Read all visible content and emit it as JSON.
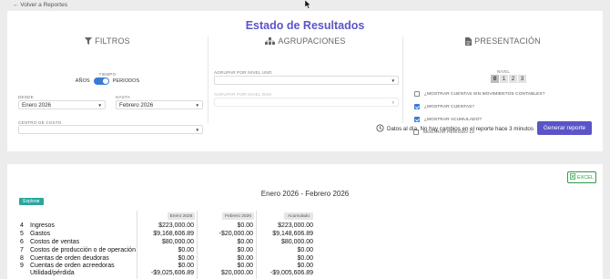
{
  "nav": {
    "back_label": "← Volver a Reportes"
  },
  "page": {
    "title": "Estado de Resultados"
  },
  "filters": {
    "heading": "FILTROS",
    "tiempo_label": "TIEMPO",
    "toggle_left": "AÑOS",
    "toggle_right": "PERIODOS",
    "toggle_state": "PERIODOS",
    "desde_label": "DESDE",
    "desde_value": "Enero 2026",
    "hasta_label": "HASTA",
    "hasta_value": "Febrero 2026",
    "centro_label": "CENTRO DE COSTO",
    "centro_value": ""
  },
  "groupings": {
    "heading": "AGRUPACIONES",
    "level1_label": "AGRUPAR POR NIVEL UNO",
    "level1_value": "",
    "level2_label": "AGRUPAR POR NIVEL DOS",
    "level2_value": ""
  },
  "presentation": {
    "heading": "PRESENTACIÓN",
    "nivel_label": "NIVEL",
    "levels": [
      "0",
      "1",
      "2",
      "3"
    ],
    "selected_level": "0",
    "options": [
      {
        "label": "¿MOSTRAR CUENTAS SIN MOVIMIENTOS CONTABLES?",
        "checked": false
      },
      {
        "label": "¿MOSTRAR CUENTAS?",
        "checked": true
      },
      {
        "label": "¿MOSTRAR ACUMULADO?",
        "checked": true
      },
      {
        "label": "MOSTRAR PERIODO 13",
        "checked": false
      }
    ]
  },
  "status": {
    "text": "Datos al día. No hay cambios en el reporte hace 3 minutos"
  },
  "actions": {
    "generate_label": "Generar reporte",
    "excel_label": "EXCEL",
    "explore_label": "Explorar"
  },
  "report": {
    "title": "Enero 2026 - Febrero 2026",
    "columns": [
      "Enero 2026",
      "Febrero 2026",
      "Acumulado"
    ],
    "rows": [
      {
        "code": "4",
        "name": "Ingresos",
        "values": [
          "$223,000.00",
          "$0.00",
          "$223,000.00"
        ]
      },
      {
        "code": "5",
        "name": "Gastos",
        "values": [
          "$9,168,606.89",
          "-$20,000.00",
          "$9,148,606.89"
        ]
      },
      {
        "code": "6",
        "name": "Costos de ventas",
        "values": [
          "$80,000.00",
          "$0.00",
          "$80,000.00"
        ]
      },
      {
        "code": "7",
        "name": "Costos de producción o de operación",
        "values": [
          "$0.00",
          "$0.00",
          "$0.00"
        ]
      },
      {
        "code": "8",
        "name": "Cuentas de orden deudoras",
        "values": [
          "$0.00",
          "$0.00",
          "$0.00"
        ]
      },
      {
        "code": "9",
        "name": "Cuentas de orden acreedoras",
        "values": [
          "$0.00",
          "$0.00",
          "$0.00"
        ]
      },
      {
        "code": "",
        "name": "Utilidad/pérdida",
        "values": [
          "-$9,025,606.89",
          "$20,000.00",
          "-$9,005,606.89"
        ]
      }
    ]
  },
  "colors": {
    "accent": "#5a54c8",
    "toggle": "#3a7bd5",
    "explore": "#2aa79c",
    "excel": "#2e9a4a"
  },
  "icons": {
    "filters": "funnel-icon",
    "groupings": "hierarchy-icon",
    "presentation": "document-icon",
    "status": "clock-history-icon",
    "excel": "spreadsheet-icon"
  }
}
